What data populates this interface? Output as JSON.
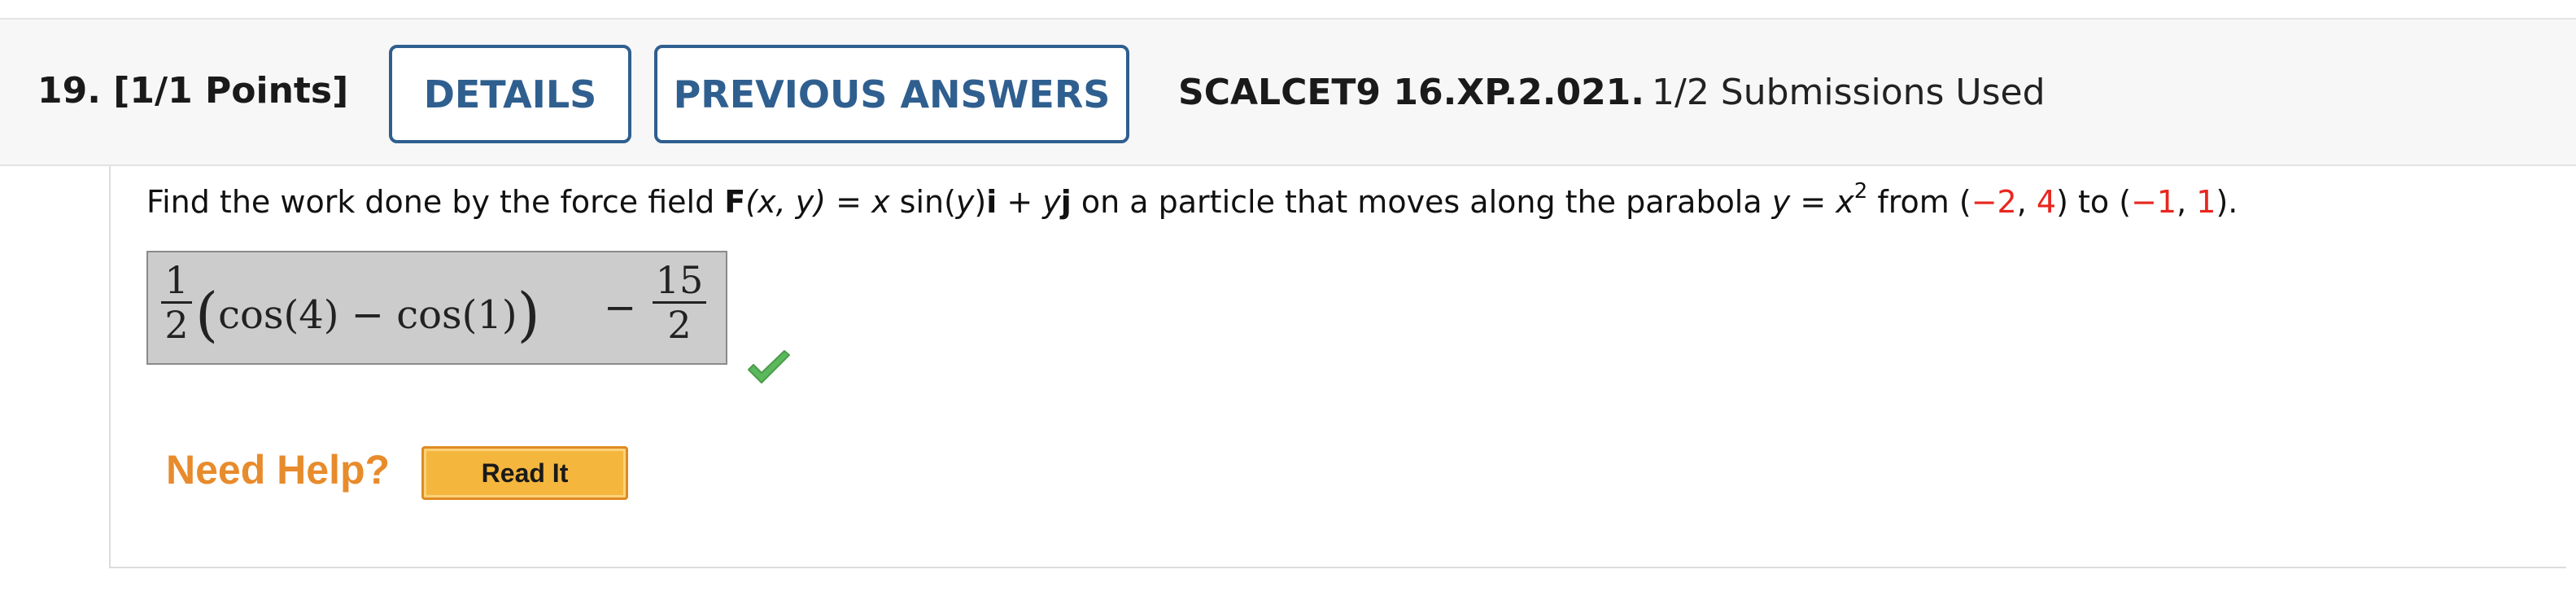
{
  "header": {
    "question_number": "19.",
    "points": "[1/1 Points]",
    "details_label": "DETAILS",
    "previous_answers_label": "PREVIOUS ANSWERS",
    "assignment_code": "SCALCET9 16.XP.2.021.",
    "submissions": "1/2 Submissions Used"
  },
  "problem": {
    "text_1": "Find the work done by the force field ",
    "F": "F",
    "args": "(x, y)",
    "text_2": " = ",
    "x1": "x",
    "sin": " sin(",
    "y1": "y",
    "close": ")",
    "i": "i",
    "plus": " + ",
    "y2": "y",
    "j": "j",
    "text_3": " on a particle that moves along the parabola ",
    "y3": "y",
    "eq": " = ",
    "x2": "x",
    "exp": "2",
    "from": " from (",
    "p1x": "−2",
    "comma1": ", ",
    "p1y": "4",
    "to": ") to (",
    "p2x": "−1",
    "comma2": ", ",
    "p2y": "1",
    "end": ")."
  },
  "answer": {
    "frac1_num": "1",
    "frac1_den": "2",
    "lparen": "(",
    "body": "cos(4) − cos(1)",
    "rparen": ")",
    "minus": "−",
    "frac2_num": "15",
    "frac2_den": "2",
    "status": "correct",
    "status_color": "#5cb85c"
  },
  "help": {
    "label": "Need Help?",
    "read_it_label": "Read It",
    "label_color": "#e88b2c"
  }
}
